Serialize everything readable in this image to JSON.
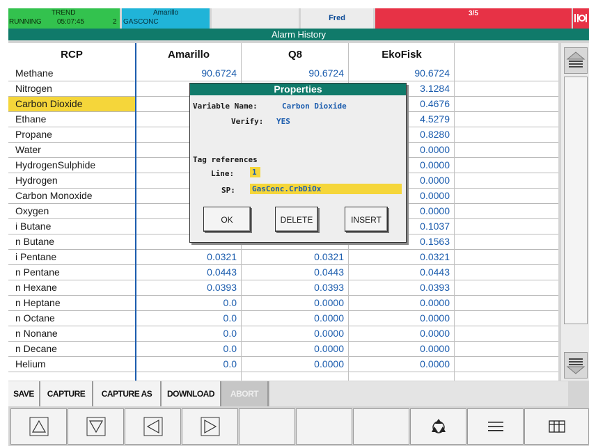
{
  "status_bar": {
    "trend_title": "TREND",
    "running_label": "RUNNING",
    "time": "05:07:45",
    "group_number": "2",
    "group_title": "Amarillo",
    "group_name": "GASCONC",
    "user": "Fred",
    "alarm_count": "3/5"
  },
  "window_title": "Alarm History",
  "table": {
    "columns": [
      "RCP",
      "Amarillo",
      "Q8",
      "EkoFisk"
    ],
    "selected_row": 2,
    "rows": [
      [
        "Methane",
        "90.6724",
        "90.6724",
        "90.6724"
      ],
      [
        "Nitrogen",
        "",
        "",
        "3.1284"
      ],
      [
        "Carbon Dioxide",
        "",
        "",
        "0.4676"
      ],
      [
        "Ethane",
        "",
        "",
        "4.5279"
      ],
      [
        "Propane",
        "",
        "",
        "0.8280"
      ],
      [
        "Water",
        "",
        "",
        "0.0000"
      ],
      [
        "HydrogenSulphide",
        "",
        "",
        "0.0000"
      ],
      [
        "Hydrogen",
        "",
        "",
        "0.0000"
      ],
      [
        "Carbon Monoxide",
        "",
        "",
        "0.0000"
      ],
      [
        "Oxygen",
        "",
        "",
        "0.0000"
      ],
      [
        "i Butane",
        "",
        "",
        "0.1037"
      ],
      [
        "n Butane",
        "",
        "",
        "0.1563"
      ],
      [
        "i Pentane",
        "0.0321",
        "0.0321",
        "0.0321"
      ],
      [
        "n Pentane",
        "0.0443",
        "0.0443",
        "0.0443"
      ],
      [
        "n Hexane",
        "0.0393",
        "0.0393",
        "0.0393"
      ],
      [
        "n Heptane",
        "0.0",
        "0.0000",
        "0.0000"
      ],
      [
        "n Octane",
        "0.0",
        "0.0000",
        "0.0000"
      ],
      [
        "n Nonane",
        "0.0",
        "0.0000",
        "0.0000"
      ],
      [
        "n Decane",
        "0.0",
        "0.0000",
        "0.0000"
      ],
      [
        "Helium",
        "0.0",
        "0.0000",
        "0.0000"
      ]
    ]
  },
  "dialog": {
    "title": "Properties",
    "variable_name_label": "Variable Name:",
    "variable_name_value": "Carbon Dioxide",
    "verify_label": "Verify:",
    "verify_value": "YES",
    "tag_references_label": "Tag references",
    "line_label": "Line:",
    "line_value": "1",
    "sp_label": "SP:",
    "sp_value": "GasConc.CrbDiOx",
    "buttons": {
      "ok": "OK",
      "delete": "DELETE",
      "insert": "INSERT"
    }
  },
  "toolbar": {
    "save": "SAVE",
    "capture": "CAPTURE",
    "capture_as": "CAPTURE AS",
    "download": "DOWNLOAD",
    "abort": "ABORT"
  },
  "nav_icons": [
    "triangle-up-icon",
    "triangle-down-icon",
    "triangle-left-icon",
    "triangle-right-icon",
    "blank",
    "blank",
    "blank",
    "recycle-icon",
    "menu-lines-icon",
    "grid-table-icon"
  ],
  "colors": {
    "teal_header": "#107a6a",
    "alarm_red": "#e73246",
    "trend_green": "#33c24e",
    "group_blue": "#20b4d8",
    "value_blue": "#1c5dae",
    "selection_yellow": "#f5d63a"
  }
}
